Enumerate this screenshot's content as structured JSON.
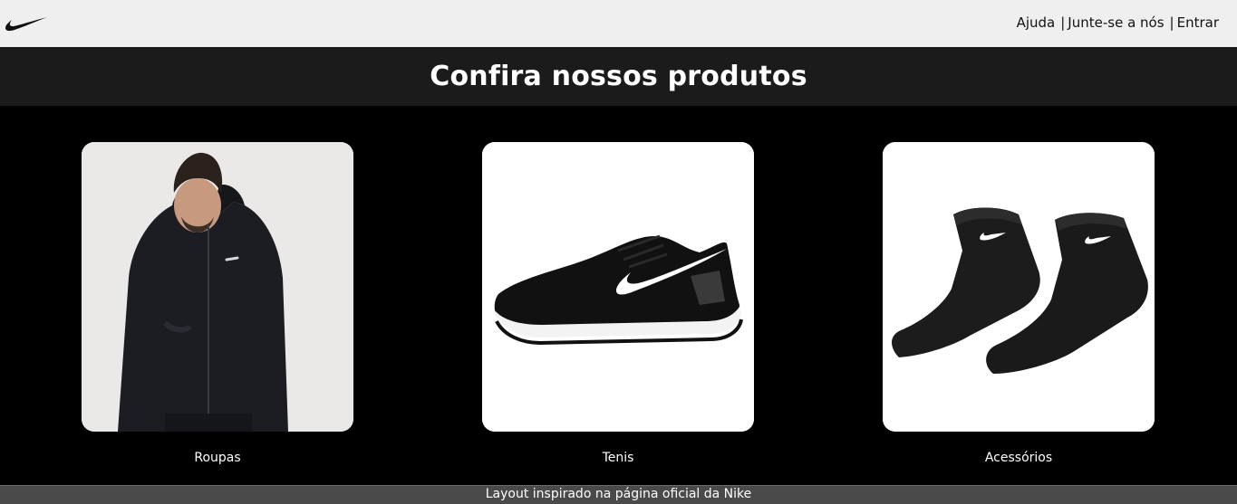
{
  "header": {
    "logo_icon": "nike-swoosh-icon",
    "nav": [
      {
        "label": "Ajuda"
      },
      {
        "label": "Junte-se a nós"
      },
      {
        "label": "Entrar"
      }
    ],
    "separator": "|"
  },
  "banner": {
    "title": "Confira nossos produtos"
  },
  "products": [
    {
      "label": "Roupas",
      "image": "hoodie-model-photo"
    },
    {
      "label": "Tenis",
      "image": "running-shoe-photo"
    },
    {
      "label": "Acessórios",
      "image": "socks-photo"
    }
  ],
  "footer": {
    "text": "Layout inspirado na página oficial da Nike"
  },
  "colors": {
    "topbar_bg": "#efefef",
    "banner_bg": "#1b1b1b",
    "page_bg": "#000000",
    "footer_bg": "#4a4a4a"
  }
}
